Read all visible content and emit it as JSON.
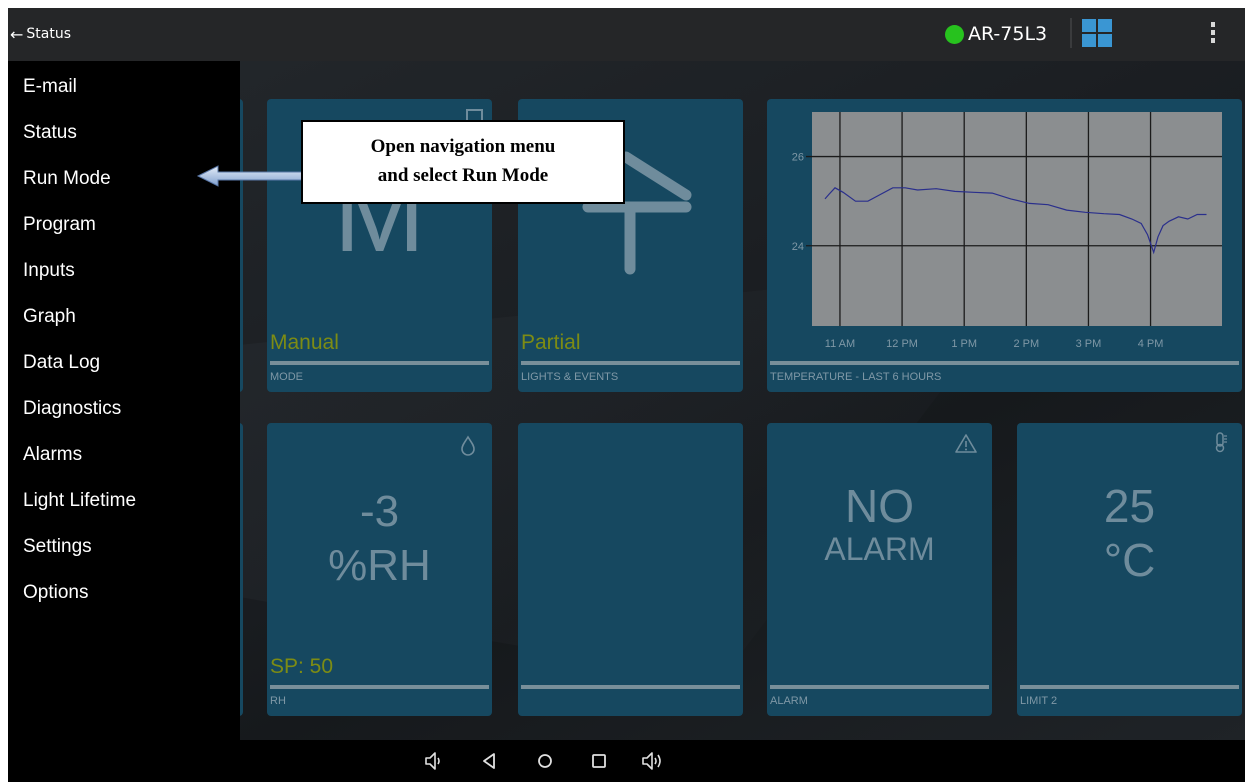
{
  "topbar": {
    "back_label": "Status",
    "device_name": "AR-75L3",
    "status_color": "#27c21e",
    "accent_color": "#3a96d3"
  },
  "drawer": {
    "items": [
      {
        "label": "E-mail"
      },
      {
        "label": "Status"
      },
      {
        "label": "Run Mode"
      },
      {
        "label": "Program"
      },
      {
        "label": "Inputs"
      },
      {
        "label": "Graph"
      },
      {
        "label": "Data Log"
      },
      {
        "label": "Diagnostics"
      },
      {
        "label": "Alarms"
      },
      {
        "label": "Light Lifetime"
      },
      {
        "label": "Settings"
      },
      {
        "label": "Options"
      }
    ]
  },
  "callout": {
    "line1": "Open navigation menu",
    "line2": "and select Run Mode"
  },
  "tiles": {
    "mode": {
      "big": "M",
      "value": "Manual",
      "label": "MODE"
    },
    "lights": {
      "value": "Partial",
      "label": "LIGHTS & EVENTS"
    },
    "temperature": {
      "label": "TEMPERATURE - LAST 6 HOURS"
    },
    "rh": {
      "line1": "-3",
      "line2": "%RH",
      "setpoint": "SP: 50",
      "label": "RH",
      "icon": "droplet-icon"
    },
    "alarm": {
      "line1": "NO",
      "line2": "ALARM",
      "label": "ALARM",
      "icon": "warning-icon"
    },
    "limit": {
      "line1": "25",
      "line2": "°C",
      "label": "LIMIT 2",
      "icon": "thermometer-icon"
    }
  },
  "chart_data": {
    "type": "line",
    "title": "TEMPERATURE - LAST 6 HOURS",
    "x_ticks": [
      "11 AM",
      "12 PM",
      "1 PM",
      "2 PM",
      "3 PM",
      "4 PM"
    ],
    "y_ticks": [
      24,
      26
    ],
    "ylim": [
      22.2,
      27.0
    ],
    "series": [
      {
        "color": "#2a2f8c",
        "x": [
          10.76,
          10.82,
          10.92,
          11.05,
          11.25,
          11.45,
          11.65,
          11.85,
          12.05,
          12.25,
          12.55,
          12.85,
          13.15,
          13.45,
          13.75,
          14.05,
          14.35,
          14.65,
          14.95,
          15.25,
          15.5,
          15.7,
          15.85,
          15.95,
          16.05,
          16.12,
          16.2,
          16.3,
          16.45,
          16.6,
          16.75,
          16.9
        ],
        "y": [
          25.05,
          25.15,
          25.3,
          25.2,
          25.0,
          25.0,
          25.15,
          25.3,
          25.3,
          25.25,
          25.28,
          25.22,
          25.2,
          25.18,
          25.05,
          24.95,
          24.92,
          24.8,
          24.75,
          24.72,
          24.7,
          24.6,
          24.5,
          24.25,
          23.85,
          24.2,
          24.45,
          24.55,
          24.65,
          24.6,
          24.7,
          24.7
        ]
      }
    ]
  }
}
